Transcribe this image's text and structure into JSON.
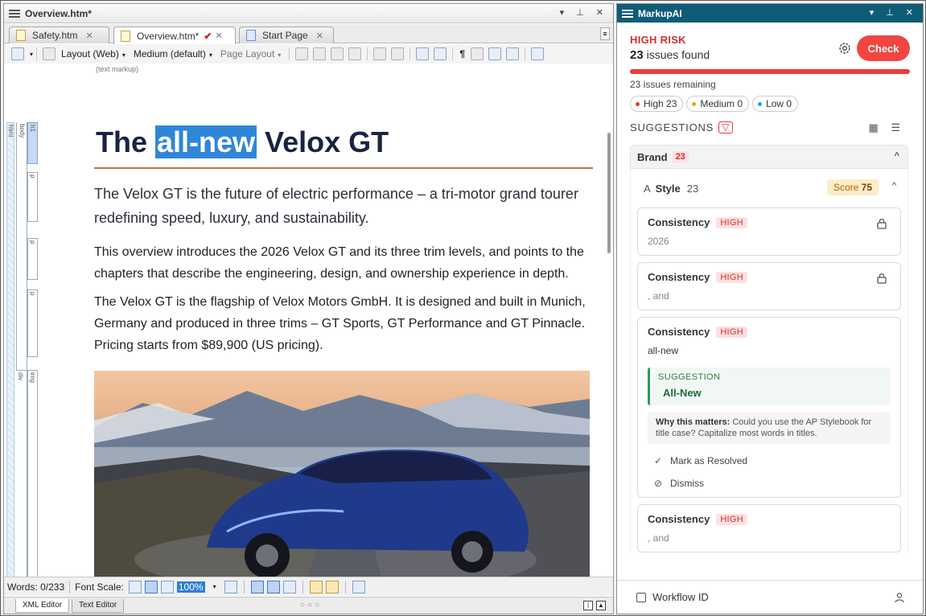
{
  "editor": {
    "window_title": "Overview.htm*",
    "window_controls": "▾ ⊥ ✕",
    "tabs": [
      {
        "label": "Safety.htm",
        "close": "✕"
      },
      {
        "label": "Overview.htm*",
        "close": "✕",
        "modified_mark": "✔"
      },
      {
        "label": "Start Page",
        "close": "✕"
      }
    ],
    "toolbar": {
      "layout": "Layout (Web)",
      "size": "Medium (default)",
      "page_layout": "Page Layout"
    },
    "text_markup": "(text markup)",
    "gutter_tags": {
      "html": "html",
      "body": "body",
      "h1": "h1",
      "p": "p",
      "div": "div",
      "img": "img"
    },
    "doc": {
      "title_pre": "The ",
      "title_hl": "all-new",
      "title_post": " Velox GT",
      "lead": "The Velox GT is the future of electric performance – a tri-motor grand tourer redefining speed, luxury, and sustainability.",
      "para1": "This overview introduces the 2026 Velox GT and its three trim levels, and points to the chapters that describe the engineering, design, and ownership experience in depth.",
      "para2": "The Velox GT is the flagship of Velox Motors GmbH. It is designed and built in Munich, Germany and produced in three trims – GT Sports, GT Performance and GT Pinnacle. Pricing starts from $89,900 (US pricing)."
    },
    "status": {
      "words": "Words: 0/233",
      "font_scale": "Font Scale:",
      "zoom": "100%"
    },
    "bottom_tabs": [
      "XML Editor",
      "Text Editor"
    ],
    "bottom_dots": "○○○"
  },
  "panel": {
    "title": "MarkupAI",
    "window_controls": "▾ ⊥ ✕",
    "risk": "HIGH RISK",
    "issues_count": "23",
    "issues_label": "issues found",
    "check_label": "Check",
    "remaining": "23 issues remaining",
    "chips": [
      {
        "label": "High 23",
        "color": "#e53935"
      },
      {
        "label": "Medium 0",
        "color": "#f0a020"
      },
      {
        "label": "Low 0",
        "color": "#1ea7d6"
      }
    ],
    "suggestions_label": "SUGGESTIONS",
    "filter_icon": "▽",
    "view_icons": "▦ ☰",
    "brand": {
      "label": "Brand",
      "count": "23",
      "chevron": "^"
    },
    "style": {
      "icon": "A",
      "label": "Style",
      "count": "23",
      "score_label": "Score",
      "score": "75",
      "chevron": "^"
    },
    "cards": [
      {
        "title": "Consistency",
        "severity": "HIGH",
        "text": "2026"
      },
      {
        "title": "Consistency",
        "severity": "HIGH",
        "text": ", and"
      },
      {
        "title": "Consistency",
        "severity": "HIGH",
        "text": "all-new",
        "suggestion_label": "SUGGESTION",
        "suggestion": "All-New",
        "why_label": "Why this matters:",
        "why_text": " Could you use the AP Stylebook for title case? Capitalize most words in titles.",
        "resolve_label": "Mark as Resolved",
        "dismiss_label": "Dismiss"
      },
      {
        "title": "Consistency",
        "severity": "HIGH",
        "text": ", and"
      }
    ],
    "workflow_label": "Workflow ID"
  }
}
